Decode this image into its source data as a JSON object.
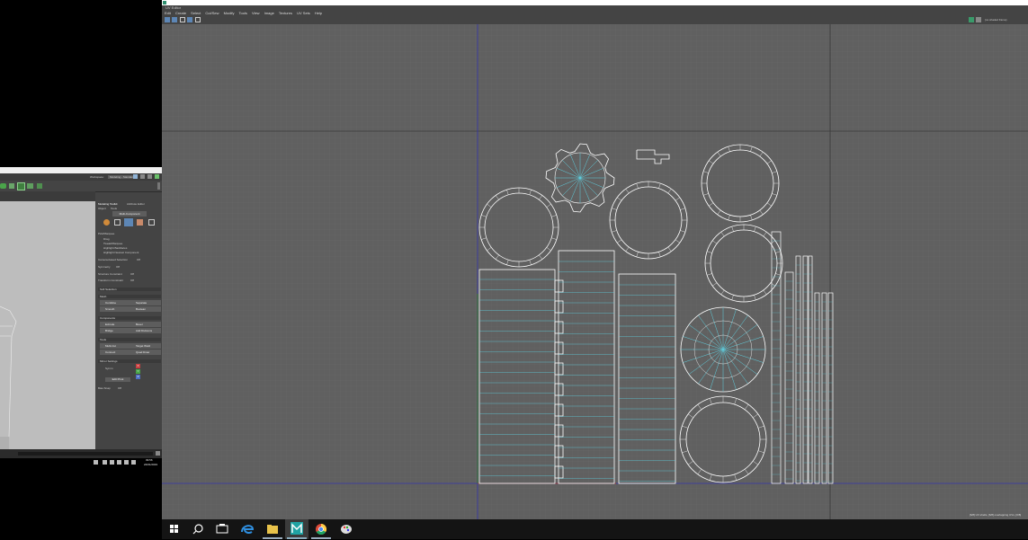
{
  "left_window": {
    "workspace_label": "Workspace:",
    "workspace_value": "Modeling - Standard",
    "panel_tabs": [
      "Modeling Toolkit",
      "Attribute Editor"
    ],
    "panel_menu": [
      "Object",
      "Tools"
    ],
    "multi_component": "Multi-Component",
    "pick_marquee": {
      "title": "Pick/Marquee",
      "items": [
        "Drag",
        "Tweak/Marquee",
        "Highlight Backfaces",
        "Highlight Nearest Component"
      ]
    },
    "camera_based": {
      "label": "Camera-based Selection",
      "value": "Off"
    },
    "symmetry": {
      "label": "Symmetry",
      "value": "Off"
    },
    "structure": {
      "label": "Structure Constraint",
      "value": "Off"
    },
    "transform": {
      "label": "Transform Constraint",
      "value": "Off"
    },
    "soft_selection": "Soft Selection",
    "sections": {
      "mesh": {
        "title": "Mesh",
        "buttons": [
          "Combine",
          "Separate",
          "Smooth",
          "Boolean"
        ]
      },
      "components": {
        "title": "Components",
        "buttons": [
          "Extrude",
          "Bevel",
          "Bridge",
          "Add Divisions"
        ]
      },
      "tools": {
        "title": "Tools",
        "buttons": [
          "Multi-Cut",
          "Target Weld",
          "Connect",
          "Quad Draw"
        ]
      },
      "mirror": {
        "title": "Mirror Settings",
        "sym_label": "Symm",
        "axes": [
          "X",
          "Y",
          "Z"
        ],
        "edit_pivot": "Edit Pivot"
      }
    },
    "bevel_snap": {
      "label": "Bias Snap",
      "value": "Off"
    },
    "clock_time": "09:56",
    "clock_date": "24/01/2019"
  },
  "uv_editor": {
    "window_title": "UV Editor",
    "menu": [
      "Edit",
      "Create",
      "Select",
      "Cut/Sew",
      "Modify",
      "Tools",
      "View",
      "Image",
      "Textures",
      "UV Sets",
      "Help"
    ],
    "toolbar_right_label": "(no shaded frame)",
    "status_text": "[6/8] UV shells, [6/8] overlapping UVs, [0/8]",
    "icons": [
      "uv-layout-icon",
      "grid-icon",
      "checker-icon",
      "snap-icon",
      "uvset-icon"
    ]
  },
  "taskbar": {
    "icons": [
      "windows-start-icon",
      "search-icon",
      "task-view-icon",
      "edge-icon",
      "file-explorer-icon",
      "maya-icon",
      "chrome-icon",
      "paint-icon"
    ]
  },
  "colors": {
    "uv_background": "#606060",
    "shell_outline": "#ffffff",
    "edge_highlight": "#5fd0e0",
    "grid_major": "#3a3a3a",
    "axis_u": "#3333aa",
    "axis_v": "#2f7f2f",
    "accent": "#5d86b5"
  }
}
